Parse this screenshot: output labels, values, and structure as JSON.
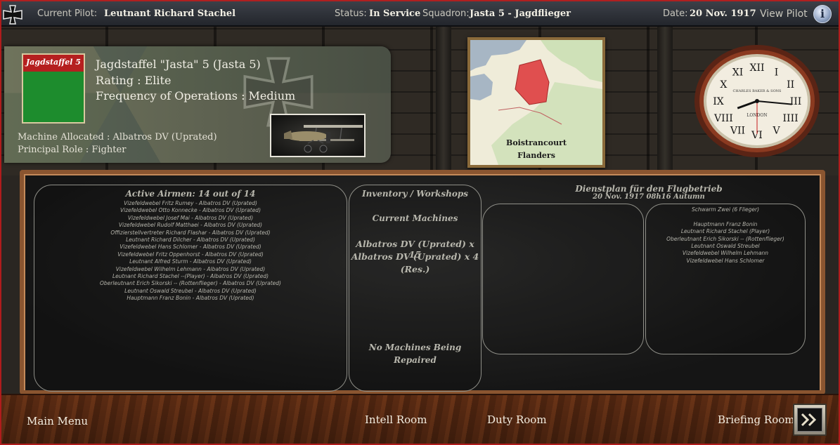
{
  "topbar": {
    "pilot_label": "Current Pilot:",
    "pilot_value": "Leutnant Richard Stachel",
    "status_label": "Status:",
    "status_value": "In Service",
    "squadron_label": "Squadron:",
    "squadron_value": "Jasta 5 - Jagdflieger",
    "date_label": "Date:",
    "date_value": "20 Nov. 1917",
    "view_pilot": "View Pilot",
    "info_glyph": "i"
  },
  "squadron": {
    "emblem_text": "Jagdstaffel 5",
    "title": "Jagdstaffel \"Jasta\" 5 (Jasta 5)",
    "rating": "Rating : Elite",
    "frequency": "Frequency of Operations : Medium",
    "machine": "Machine Allocated : Albatros DV (Uprated)",
    "role": "Principal Role : Fighter",
    "emblem_colors": {
      "top": "#b51f1f",
      "bottom": "#1d8c2d"
    }
  },
  "map": {
    "location": "Boistrancourt",
    "region": "Flanders"
  },
  "clock": {
    "maker_line": "CHARLES BAKER & SONS",
    "city": "LONDON",
    "numerals": [
      "XII",
      "I",
      "II",
      "III",
      "IIII",
      "V",
      "VI",
      "VII",
      "VIII",
      "IX",
      "X",
      "XI"
    ],
    "time": "08:16"
  },
  "airmen": {
    "header": "Active Airmen: 14 out of  14",
    "list": [
      "Vizefeldwebel Fritz Rumey  -  Albatros DV (Uprated)",
      "Vizefeldwebel Otto Konnecke  -  Albatros DV (Uprated)",
      "Vizefeldwebel Josef Mai  -  Albatros DV (Uprated)",
      "Vizefeldwebel Rudolf Matthaei  -  Albatros DV (Uprated)",
      "Offizierstellvertreter Richard Flashar  -  Albatros DV (Uprated)",
      "Leutnant Richard Dilcher  -  Albatros DV (Uprated)",
      "Vizefeldwebel Hans Schlomer  -  Albatros DV (Uprated)",
      "Vizefeldwebel Fritz Oppenhorst  -  Albatros DV (Uprated)",
      "Leutnant Alfred Sturm  -  Albatros DV (Uprated)",
      "Vizefeldwebel Wilhelm Lehmann  -  Albatros DV (Uprated)",
      "Leutnant  Richard  Stachel  --(Player) - Albatros DV (Uprated)",
      "Oberleutnant Erich Sikorski  -- (Rottenflieger) - Albatros DV (Uprated)",
      "Leutnant Oswald Streubel  -  Albatros DV (Uprated)",
      "Hauptmann Franz Bonin  -  Albatros DV (Uprated)"
    ]
  },
  "inventory": {
    "header": "Inventory / Workshops",
    "current_label": "Current Machines",
    "line1": "Albatros DV (Uprated) x 15",
    "line2": "Albatros DV (Uprated) x 4",
    "line3": "(Res.)",
    "repair1": "No Machines Being",
    "repair2": "Repaired"
  },
  "schedule": {
    "title": "Dienstplan für den Flugbetrieb",
    "subtitle": "20 Nov. 1917 08h16 Autumn",
    "list": [
      "Schwarm Zwei  (6 Flieger)",
      "",
      "Hauptmann Franz Bonin",
      "Leutnant Richard Stachel (Player)",
      "Oberleutnant Erich Sikorski  -- (Rottenflieger)",
      "Leutnant Oswald Streubel",
      "Vizefeldwebel Wilhelm Lehmann",
      "Vizefeldwebel Hans Schlomer"
    ]
  },
  "nav": {
    "main_menu": "Main Menu",
    "intell_room": "Intell Room",
    "duty_room": "Duty Room",
    "briefing_room": "Briefing Room"
  }
}
